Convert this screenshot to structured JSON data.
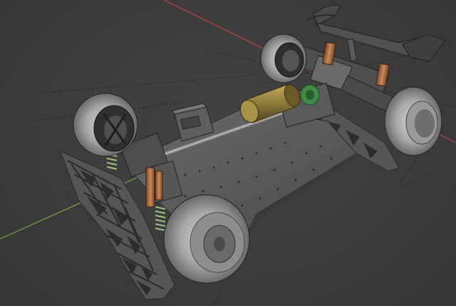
{
  "viewport": {
    "view": "perspective",
    "grid_floor": true,
    "object": "rc-drift-car-chassis",
    "axis_x_color": "#c0404a",
    "axis_y_color": "#7fa63a"
  },
  "colors": {
    "background": "#3c3c3c",
    "chassis_plate": "#5a5a5a",
    "tire": "#b4b4b4",
    "motor": "#8c7a3c",
    "shock_body": "#a8653a",
    "spring": "#9ec07a",
    "gear": "#3f8a46",
    "carbon_frame": "#585858"
  }
}
